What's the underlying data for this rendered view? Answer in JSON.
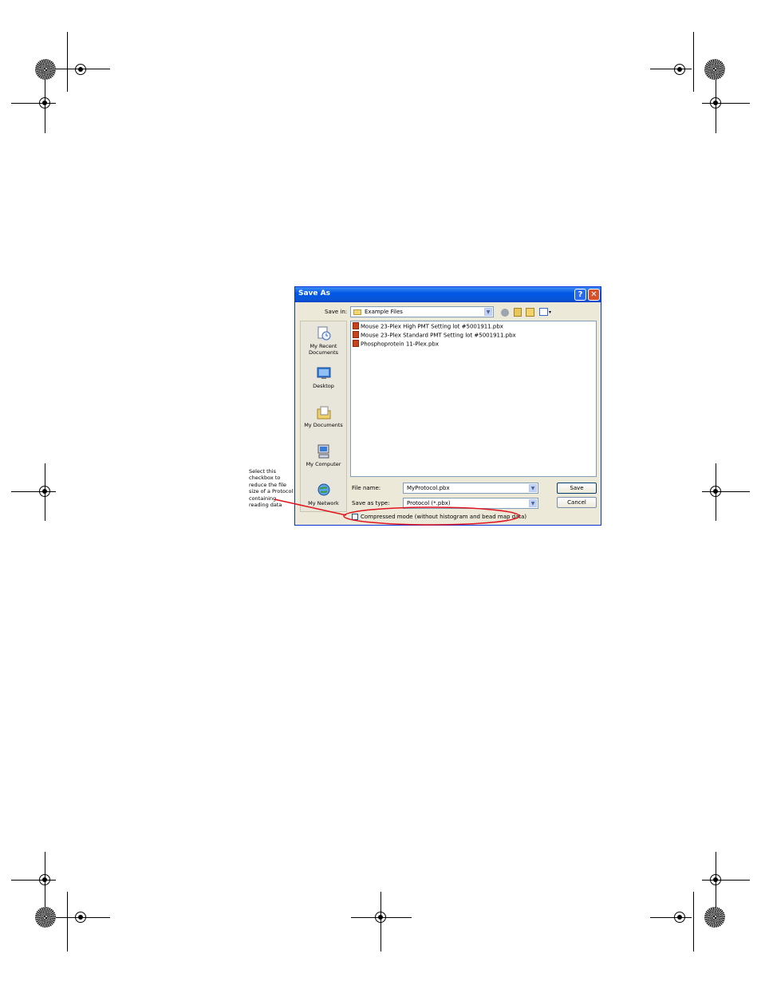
{
  "dialog": {
    "title": "Save As",
    "save_in_label": "Save in:",
    "save_in_value": "Example Files",
    "places": [
      {
        "label": "My Recent Documents",
        "icon": "recent-documents-icon"
      },
      {
        "label": "Desktop",
        "icon": "desktop-icon"
      },
      {
        "label": "My Documents",
        "icon": "my-documents-icon"
      },
      {
        "label": "My Computer",
        "icon": "my-computer-icon"
      },
      {
        "label": "My Network",
        "icon": "my-network-icon"
      }
    ],
    "files": [
      "Mouse 23-Plex High PMT Setting lot #5001911.pbx",
      "Mouse 23-Plex Standard PMT Setting lot #5001911.pbx",
      "Phosphoprotein 11-Plex.pbx"
    ],
    "file_name_label": "File name:",
    "file_name_value": "MyProtocol.pbx",
    "save_as_type_label": "Save as type:",
    "save_as_type_value": "Protocol (*.pbx)",
    "save_button": "Save",
    "cancel_button": "Cancel",
    "compressed_label": "Compressed mode (without histogram and bead map data)",
    "compressed_checked": false
  },
  "annotation": "Select this checkbox to reduce the file size of a Protocol containing reading data",
  "colors": {
    "titlebar": "#0058e6",
    "dialog_bg": "#ece9d8",
    "highlight_ellipse": "#e0141e"
  }
}
